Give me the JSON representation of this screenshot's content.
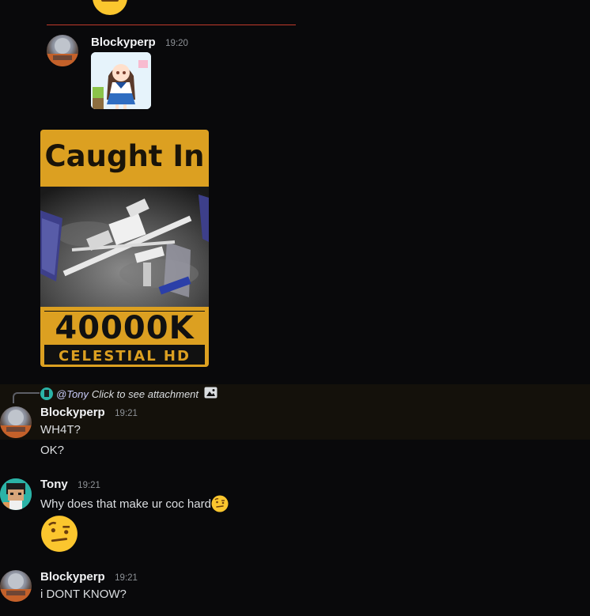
{
  "messages": [
    {
      "author": "Blockyperp",
      "time": "19:20",
      "attachment_name": "anime-girl-sticker"
    },
    {
      "attachment_title_top": "Caught In",
      "attachment_title_big": "40000K",
      "attachment_title_sub": "CELESTIAL HD"
    },
    {
      "reply": {
        "mention": "@Tony",
        "text": "Click to see attachment",
        "icon": "image-icon"
      },
      "author": "Blockyperp",
      "time": "19:21",
      "lines": [
        "WH4T?",
        "OK?"
      ]
    },
    {
      "author": "Tony",
      "time": "19:21",
      "text": "Why does that make ur coc hard",
      "emoji": "face-with-raised-eyebrow"
    },
    {
      "author": "Blockyperp",
      "time": "19:21",
      "text": "i DONT KNOW?"
    }
  ],
  "colors": {
    "background": "#09090b",
    "highlight": "#14110b",
    "divider": "#c0392b",
    "poster_gold": "#dca021"
  }
}
